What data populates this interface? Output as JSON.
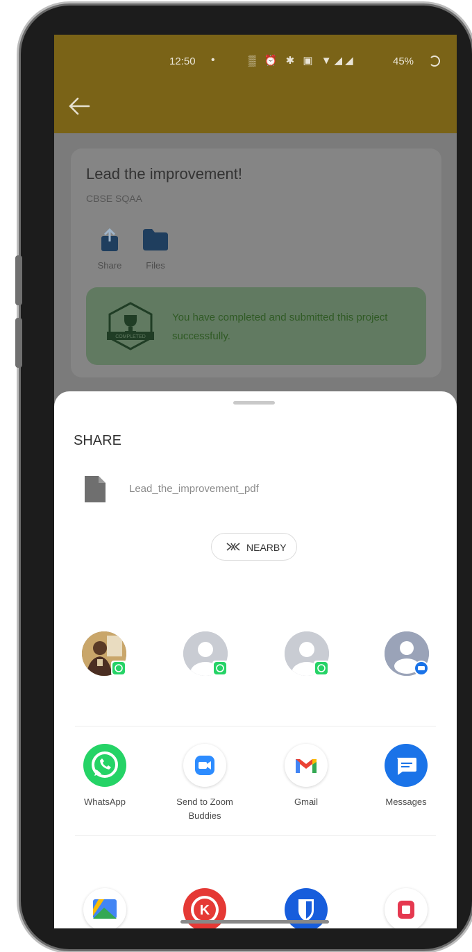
{
  "status_bar": {
    "time": "12:50",
    "dot": "•",
    "icons": "▒ ⏰ ✱ ▣ ▼◢◢",
    "battery": "45%"
  },
  "project": {
    "title": "Lead the improvement!",
    "subtitle": "CBSE SQAA",
    "actions": [
      {
        "label": "Share",
        "icon": "share-icon"
      },
      {
        "label": "Files",
        "icon": "folder-icon"
      }
    ],
    "banner_text": "You have completed and submitted this project successfully.",
    "badge_text": "COMPLETED"
  },
  "share_sheet": {
    "title": "SHARE",
    "file_name": "Lead_the_improvement_pdf",
    "nearby_label": "NEARBY",
    "contacts": [
      {
        "kind": "photo",
        "app_badge": "whatsapp"
      },
      {
        "kind": "placeholder",
        "app_badge": "whatsapp"
      },
      {
        "kind": "placeholder",
        "app_badge": "whatsapp"
      },
      {
        "kind": "placeholder",
        "app_badge": "messages"
      }
    ],
    "apps_row1": [
      {
        "label": "WhatsApp",
        "color": "#25d366"
      },
      {
        "label": "Send to Zoom Buddies",
        "color": "#2d8cff"
      },
      {
        "label": "Gmail",
        "color": "#ea4335"
      },
      {
        "label": "Messages",
        "color": "#1a73e8"
      }
    ],
    "apps_row2": [
      {
        "label": "",
        "icon": "files-app-icon"
      },
      {
        "label": "",
        "icon": "kinemaster-icon",
        "letter": "K"
      },
      {
        "label": "",
        "icon": "bitwarden-icon"
      },
      {
        "label": "",
        "icon": "red-app-icon"
      }
    ]
  },
  "colors": {
    "appbar": "#7a6317",
    "banner": "#617a61",
    "whatsapp": "#25d366"
  }
}
